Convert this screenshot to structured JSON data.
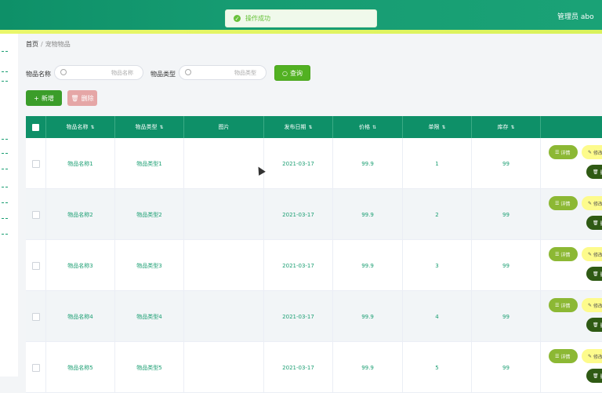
{
  "header": {
    "admin_label": "管理员 abo",
    "toast_message": "操作成功"
  },
  "breadcrumb": {
    "home": "首页",
    "separator": "/",
    "current": "宠物物品"
  },
  "filters": [
    {
      "label": "物品名称",
      "placeholder": "物品名称"
    },
    {
      "label": "物品类型",
      "placeholder": "物品类型"
    }
  ],
  "buttons": {
    "search": "查询",
    "add": "新增",
    "delete": "删除"
  },
  "table": {
    "headers": [
      "物品名称",
      "物品类型",
      "图片",
      "发布日期",
      "价格",
      "单限",
      "库存"
    ],
    "rows": [
      {
        "name": "物品名称1",
        "type": "物品类型1",
        "date": "2021-03-17",
        "price": "99.9",
        "limit": "1",
        "stock": "99"
      },
      {
        "name": "物品名称2",
        "type": "物品类型2",
        "date": "2021-03-17",
        "price": "99.9",
        "limit": "2",
        "stock": "99"
      },
      {
        "name": "物品名称3",
        "type": "物品类型3",
        "date": "2021-03-17",
        "price": "99.9",
        "limit": "3",
        "stock": "99"
      },
      {
        "name": "物品名称4",
        "type": "物品类型4",
        "date": "2021-03-17",
        "price": "99.9",
        "limit": "4",
        "stock": "99"
      },
      {
        "name": "物品名称5",
        "type": "物品类型5",
        "date": "2021-03-17",
        "price": "99.9",
        "limit": "5",
        "stock": "99"
      }
    ],
    "row_actions": {
      "detail": "详情",
      "edit": "修改",
      "delete": "删除"
    }
  },
  "colors": {
    "primary": "#0e9068",
    "accent": "#eaf76a",
    "success": "#67c23a"
  }
}
